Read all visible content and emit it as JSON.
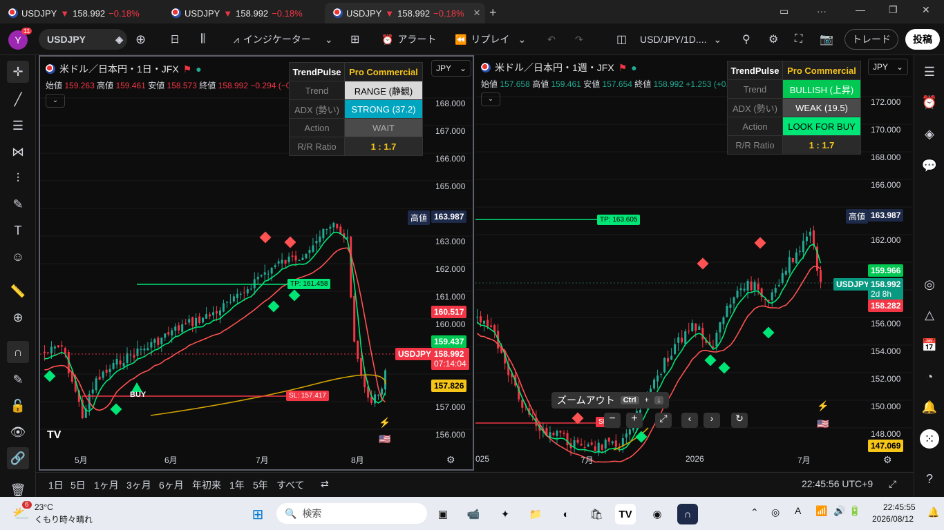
{
  "tabs": [
    {
      "symbol": "USDJPY",
      "price": "158.992",
      "change": "−0.18%"
    },
    {
      "symbol": "USDJPY",
      "price": "158.992",
      "change": "−0.18%"
    },
    {
      "symbol": "USDJPY",
      "price": "158.992",
      "change": "−0.18%"
    }
  ],
  "toolbar": {
    "avatar": "Y",
    "badge": "11",
    "symbol": "USDJPY",
    "interval": "日",
    "indicators": "インジケーター",
    "alert": "アラート",
    "replay": "リプレイ",
    "layout_name": "USD/JPY/1D....",
    "trade": "トレード",
    "publish": "投稿"
  },
  "pane1": {
    "title": "米ドル／日本円・1日・JFX",
    "ohlc": {
      "open_label": "始値",
      "open": "159.263",
      "high_label": "高値",
      "high": "159.461",
      "low_label": "安値",
      "low": "158.573",
      "close_label": "終値",
      "close": "158.992",
      "change": "−0.294 (−0.18%)"
    },
    "currency": "JPY",
    "table": {
      "h1": "TrendPulse",
      "h2": "Pro Commercial",
      "r1l": "Trend",
      "r1v": "RANGE (静観)",
      "r2l": "ADX (勢い)",
      "r2v": "STRONG (37.2)",
      "r3l": "Action",
      "r3v": "WAIT",
      "r4l": "R/R Ratio",
      "r4v": "1 : 1.7"
    },
    "prices": [
      "168.000",
      "167.000",
      "166.000",
      "165.000",
      "163.000",
      "162.000",
      "161.000",
      "160.000",
      "157.000",
      "156.000"
    ],
    "labels": {
      "high_tag": "高値",
      "high_val": "163.987",
      "l1": "160.517",
      "l2": "159.437",
      "sym": "USDJPY",
      "cur": "158.992",
      "timer": "07:14:04",
      "l3": "157.826",
      "tp": "TP: 161.458",
      "sl": "SL: 157.417",
      "buy": "BUY",
      "partial": "158.0"
    },
    "xlabels": [
      "5月",
      "6月",
      "7月",
      "8月"
    ]
  },
  "pane2": {
    "title": "米ドル／日本円・1週・JFX",
    "ohlc": {
      "open_label": "始値",
      "open": "157.658",
      "high_label": "高値",
      "high": "159.461",
      "low_label": "安値",
      "low": "157.654",
      "close_label": "終値",
      "close": "158.992",
      "change": "+1.253 (+0.79%)"
    },
    "currency": "JPY",
    "table": {
      "h1": "TrendPulse",
      "h2": "Pro Commercial",
      "r1l": "Trend",
      "r1v": "BULLISH (上昇)",
      "r2l": "ADX (勢い)",
      "r2v": "WEAK (19.5)",
      "r3l": "Action",
      "r3v": "LOOK FOR BUY",
      "r4l": "R/R Ratio",
      "r4v": "1 : 1.7"
    },
    "prices": [
      "172.000",
      "170.000",
      "168.000",
      "166.000",
      "162.000",
      "156.000",
      "154.000",
      "152.000",
      "150.000",
      "148.000"
    ],
    "labels": {
      "high_tag": "高値",
      "high_val": "163.987",
      "l1": "159.966",
      "sym": "USDJPY",
      "cur": "158.992",
      "timer": "2d 8h",
      "l2": "158.282",
      "l3": "147.069",
      "tp": "TP: 163.605",
      "sl": "SL"
    },
    "xlabels": [
      "025",
      "7月",
      "2026",
      "7月"
    ],
    "zoom": {
      "label": "ズームアウト",
      "key": "Ctrl",
      "plus": "+",
      "arrow": "↓"
    }
  },
  "bottom": {
    "ranges": [
      "1日",
      "5日",
      "1ヶ月",
      "3ヶ月",
      "6ヶ月",
      "年初来",
      "1年",
      "5年",
      "すべて"
    ],
    "time": "22:45:56 UTC+9"
  },
  "taskbar": {
    "weather_temp": "23°C",
    "weather_desc": "くもり時々晴れ",
    "weather_badge": "6",
    "search": "検索",
    "time": "22:45:55",
    "date": "2026/08/12"
  },
  "colors": {
    "up": "#22ab94",
    "down": "#f23645",
    "ema_fast": "#00e676",
    "ema_slow": "#ff5252",
    "sma": "#d4a500"
  }
}
